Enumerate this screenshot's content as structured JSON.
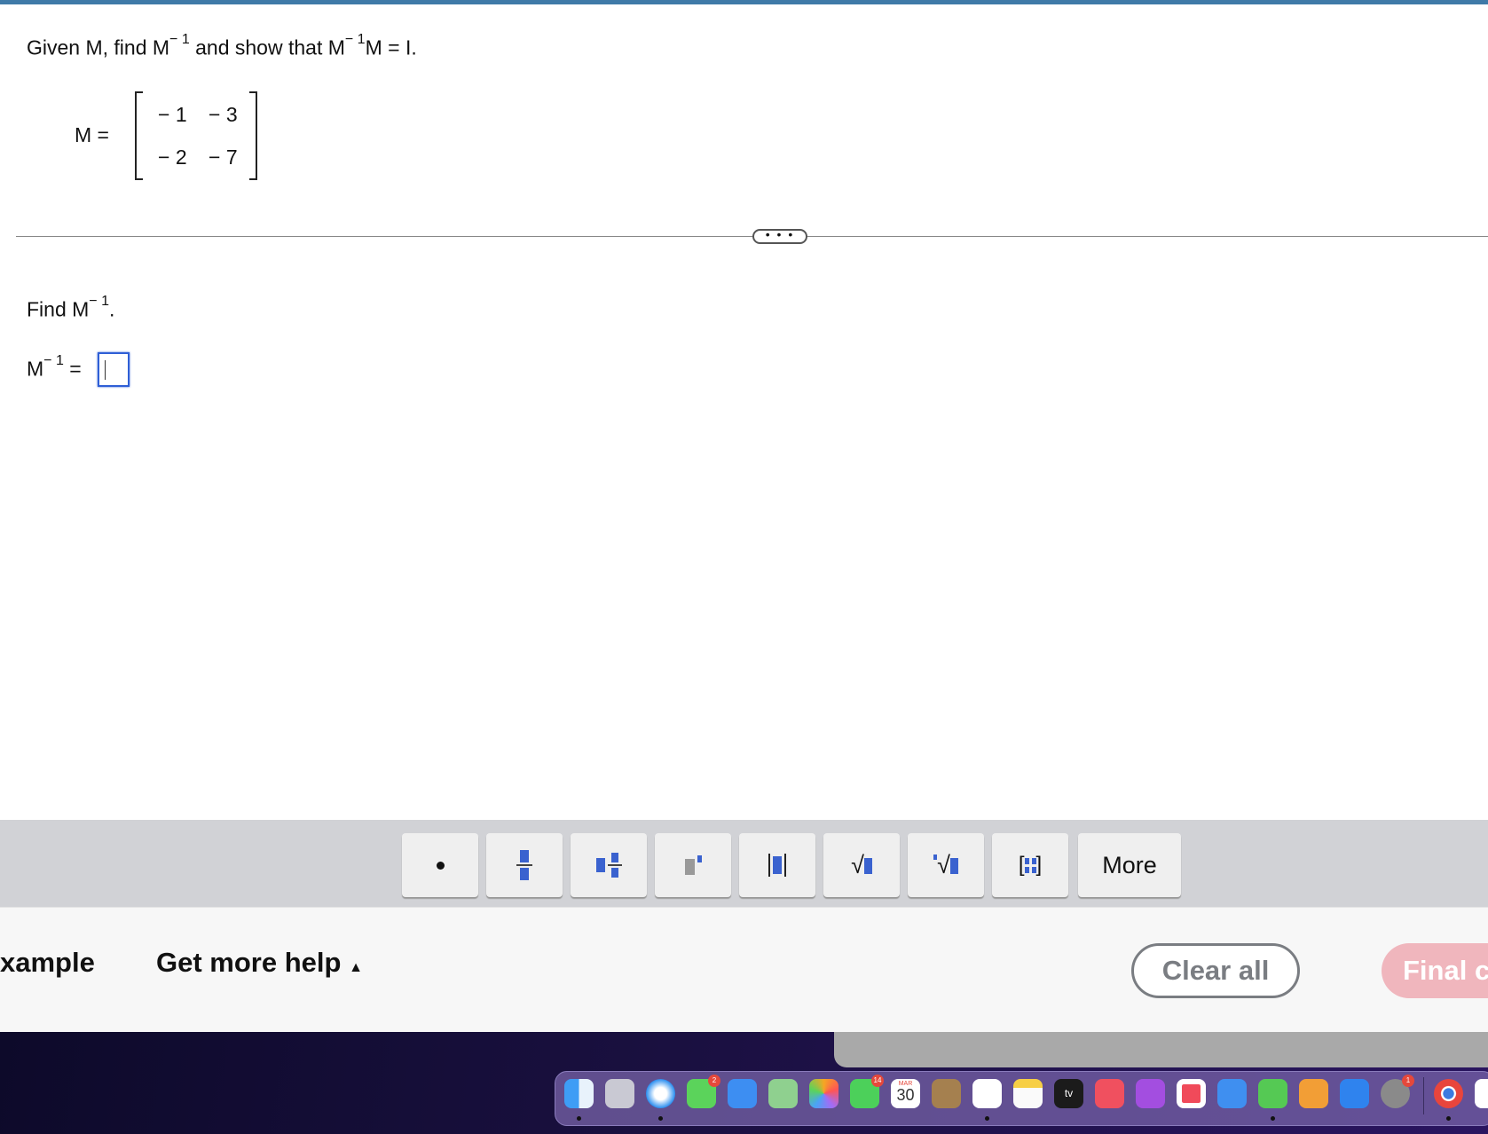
{
  "question": {
    "p1": "Given M, find M",
    "sup": "− 1",
    "p2": " and show that M",
    "p3": "M = I."
  },
  "matrix": {
    "label": "M  =",
    "rows": [
      [
        "− 1",
        "− 3"
      ],
      [
        "− 2",
        "− 7"
      ]
    ]
  },
  "divider_label": "• • •",
  "part": {
    "find": "Find M",
    "sup": "− 1",
    "period": ".",
    "ans_label": "M",
    "eq": "="
  },
  "toolbar": {
    "buttons": [
      "dot",
      "fraction",
      "mixed-number",
      "exponent",
      "absolute-value",
      "square-root",
      "nth-root",
      "matrix"
    ],
    "more": "More"
  },
  "bottom": {
    "example": "xample",
    "help": "Get more help",
    "help_arrow": "▲",
    "clear": "Clear all",
    "final": "Final c"
  },
  "dock": {
    "apps": [
      "finder",
      "launchpad",
      "safari",
      "messages",
      "mail",
      "maps",
      "photos",
      "facetime",
      "calendar",
      "contacts",
      "reminders",
      "notes",
      "tv",
      "music",
      "podcasts",
      "news",
      "keynote",
      "numbers",
      "pages",
      "app-store",
      "system-settings",
      "chrome"
    ],
    "badges": {
      "messages": "2",
      "facetime": "14",
      "system-settings": "1"
    },
    "calendar_month": "MAR",
    "calendar_day": "30",
    "tv_label": "tv"
  }
}
